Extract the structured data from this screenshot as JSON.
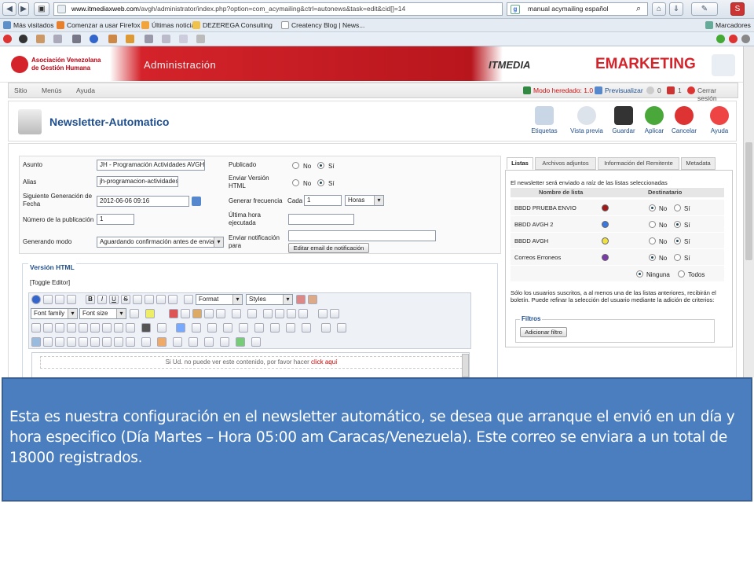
{
  "browser": {
    "url_host": "www.itmediaxweb.com",
    "url_path": "/avgh/administrator/index.php?option=com_acymailing&ctrl=autonews&task=edit&cid[]=14",
    "search_text": "manual acymailing español",
    "bookmarks": [
      "Más visitados",
      "Comenzar a usar Firefox",
      "Últimas noticias",
      "DEZEREGA Consulting",
      "Creatency Blog | News..."
    ],
    "bookmarks_right": "Marcadores"
  },
  "header": {
    "org_line1": "Asociación Venezolana",
    "org_line2": "de Gestión Humana",
    "admin_label": "Administración",
    "itmedia_logo": "ITMEDIA",
    "emarketing_logo": "EMARKETING"
  },
  "menu": {
    "items": [
      "Sitio",
      "Menús",
      "Ayuda"
    ],
    "status_mode": "Modo heredado: 1.0",
    "preview": "Previsualizar",
    "count_a": "0",
    "count_b": "1",
    "logout": "Cerrar sesión"
  },
  "toolbar": {
    "title": "Newsletter-Automatico",
    "buttons": [
      "Etiquetas",
      "Vista previa",
      "Guardar",
      "Aplicar",
      "Cancelar",
      "Ayuda"
    ]
  },
  "form": {
    "asunto_label": "Asunto",
    "asunto_value": "JH - Programación Actividades AVGH Ju",
    "alias_label": "Alias",
    "alias_value": "jh-programacion-actividades-a",
    "next_gen_label": "Siguiente Generación de Fecha",
    "next_gen_value": "2012-06-06 09:16",
    "pub_num_label": "Número de la publicación",
    "pub_num_value": "1",
    "gen_mode_label": "Generando modo",
    "gen_mode_value": "Aguardando confirmación antes de enviar",
    "published_label": "Publicado",
    "html_label": "Enviar Versión HTML",
    "no": "No",
    "si": "Sí",
    "freq_label": "Generar frecuencia",
    "freq_prefix": "Cada",
    "freq_value": "1",
    "freq_unit": "Horas",
    "last_hour_label": "Última hora ejecutada",
    "notify_label": "Enviar notificación para",
    "notify_button": "Editar email de notificación"
  },
  "editor": {
    "legend": "Versión HTML",
    "toggle": "[Toggle Editor]",
    "format": "Format",
    "styles": "Styles",
    "font_family": "Font family",
    "font_size": "Font size",
    "notice": "Si Ud. no puede ver este contenido, por favor hacer",
    "notice_link": "click aquí"
  },
  "lists_panel": {
    "tabs": [
      "Listas",
      "Archivos adjuntos",
      "Información del Remitente",
      "Metadata"
    ],
    "intro": "El newsletter será enviado a raíz de las listas seleccionadas",
    "col_name": "Nombre de lista",
    "col_dest": "Destinatario",
    "rows": [
      {
        "name": "BBDD PRUEBA ENVIO",
        "color": "#a01818",
        "selected": "No"
      },
      {
        "name": "BBDD AVGH 2",
        "color": "#3a78e0",
        "selected": "Sí"
      },
      {
        "name": "BBDD AVGH",
        "color": "#f0e040",
        "selected": "Sí"
      },
      {
        "name": "Correos Erroneos",
        "color": "#7a3aa8",
        "selected": "No"
      }
    ],
    "none_label": "Ninguna",
    "all_label": "Todos",
    "note": "Sólo los usuarios suscritos, a al menos una de las listas anteriores, recibirán el boletín. Puede refinar la selección del usuario mediante la adición de criterios:",
    "filters_legend": "Filtros",
    "add_filter": "Adicionar filtro"
  },
  "overlay": {
    "text": "Esta es nuestra configuración en el newsletter automático, se desea que arranque el envió en un día y hora especifico (Día Martes – Hora 05:00 am Caracas/Venezuela). Este correo se enviara a un total de 18000 registrados."
  },
  "colors": {
    "accent_blue": "#1f4e8c",
    "overlay_bg": "#4a7ebf",
    "brand_red": "#d4232a"
  }
}
